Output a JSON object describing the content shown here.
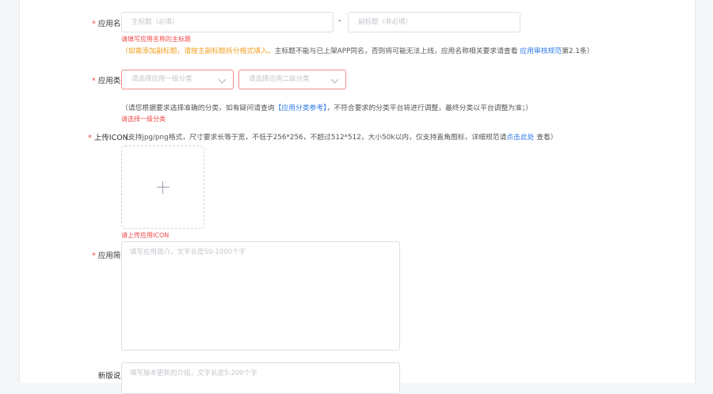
{
  "form": {
    "app_name": {
      "required_mark": "*",
      "label": "应用名称:",
      "main_title_placeholder": "主标题（必填）",
      "separator": "-",
      "sub_title_placeholder": "副标题（非必填）",
      "error": "请填写应用名称的主标题",
      "hint_prefix": "（",
      "hint_orange": "如需添加副标题，请按主副标题拆分格式填入。",
      "hint_mid": "主标题不能与已上架APP同名，否则将可能无法上线，应用名称相关要求请查看 ",
      "hint_link": "应用审核规范",
      "hint_suffix": "第2.1条）"
    },
    "app_category": {
      "required_mark": "*",
      "label": "应用类别:",
      "level1_placeholder": "请选择应用一级分类",
      "level2_placeholder": "请选择应用二级分类",
      "hint_prefix": "（请您根据要求选择准确的分类，如有疑问请查询",
      "hint_link": "【应用分类参考】",
      "hint_suffix": "，不符合要求的分类平台将进行调整，最终分类以平台调整为准；）",
      "error": "请选择一级分类"
    },
    "app_icon": {
      "required_mark": "*",
      "label": "上传ICON:",
      "hint_prefix": "（支持jpg/png格式，尺寸要求长等于宽，不低于256*256，不超过512*512，大小50k以内，仅支持直角图标，详细规范请",
      "hint_link": "点击此处",
      "hint_suffix": " 查看）",
      "error": "请上传应用ICON"
    },
    "app_intro": {
      "required_mark": "*",
      "label": "应用简介:",
      "placeholder": "填写应用简介，文字长度50-1000个字"
    },
    "release_notes": {
      "label": "新版说明:",
      "placeholder": "填写版本更新的介绍，文字长度5-200个字"
    }
  },
  "icons": {
    "upload": "plus-icon",
    "dropdown": "chevron-down-icon"
  },
  "colors": {
    "required": "#f04848",
    "link": "#2d7be5",
    "warning": "#f0a020",
    "error_border": "#f08a8a"
  }
}
